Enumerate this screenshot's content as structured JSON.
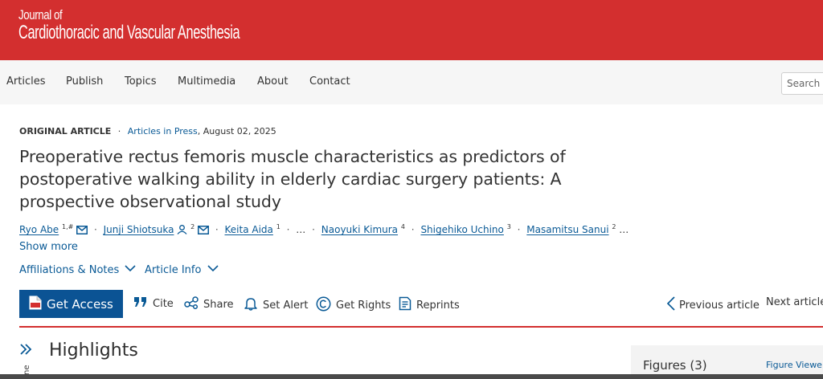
{
  "header": {
    "journal_line1": "Journal of",
    "journal_line2": "Cardiothoracic and Vascular Anesthesia",
    "brand_color": "#d32f2f"
  },
  "nav": {
    "items": [
      "Articles",
      "Publish",
      "Topics",
      "Multimedia",
      "About",
      "Contact"
    ],
    "search_placeholder": "Search fo"
  },
  "article": {
    "type": "ORIGINAL ARTICLE",
    "dot": "·",
    "in_press": "Articles in Press",
    "date": ", August 02, 2025",
    "title": "Preoperative rectus femoris muscle characteristics as predictors of postoperative walking ability in elderly cardiac surgery patients: A prospective observational study",
    "authors": [
      {
        "name": "Ryo Abe",
        "sup": "1,#"
      },
      {
        "name": "Junji Shiotsuka",
        "sup": "2"
      },
      {
        "name": "Keita Aida",
        "sup": "1"
      },
      {
        "name": "Naoyuki Kimura",
        "sup": "4"
      },
      {
        "name": "Shigehiko Uchino",
        "sup": "3"
      },
      {
        "name": "Masamitsu Sanui",
        "sup": "2"
      }
    ],
    "ellipsis": "…",
    "show_more": "Show more",
    "affiliations": "Affiliations & Notes",
    "article_info": "Article Info"
  },
  "toolbar": {
    "get_access": "Get Access",
    "cite": "Cite",
    "share": "Share",
    "set_alert": "Set Alert",
    "get_rights": "Get Rights",
    "reprints": "Reprints",
    "previous": "Previous article",
    "next": "Next article"
  },
  "content": {
    "outline_label": "ne",
    "highlights": "Highlights",
    "figures": "Figures (3)",
    "figure_viewer": "Figure Viewer"
  },
  "colors": {
    "link": "#0a5a96",
    "button": "#0b5394"
  }
}
